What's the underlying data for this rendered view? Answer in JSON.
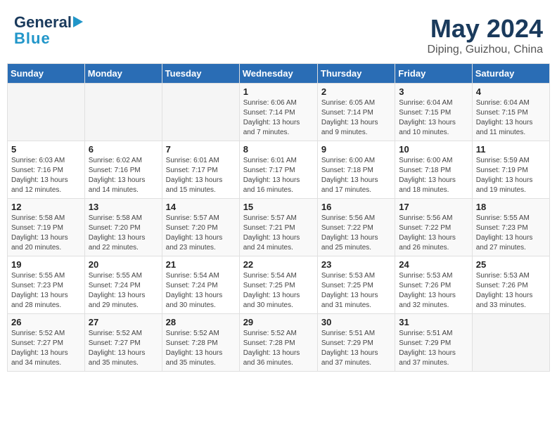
{
  "header": {
    "logo_line1": "General",
    "logo_line2": "Blue",
    "title": "May 2024",
    "subtitle": "Diping, Guizhou, China"
  },
  "weekdays": [
    "Sunday",
    "Monday",
    "Tuesday",
    "Wednesday",
    "Thursday",
    "Friday",
    "Saturday"
  ],
  "weeks": [
    [
      {
        "day": "",
        "info": ""
      },
      {
        "day": "",
        "info": ""
      },
      {
        "day": "",
        "info": ""
      },
      {
        "day": "1",
        "info": "Sunrise: 6:06 AM\nSunset: 7:14 PM\nDaylight: 13 hours\nand 7 minutes."
      },
      {
        "day": "2",
        "info": "Sunrise: 6:05 AM\nSunset: 7:14 PM\nDaylight: 13 hours\nand 9 minutes."
      },
      {
        "day": "3",
        "info": "Sunrise: 6:04 AM\nSunset: 7:15 PM\nDaylight: 13 hours\nand 10 minutes."
      },
      {
        "day": "4",
        "info": "Sunrise: 6:04 AM\nSunset: 7:15 PM\nDaylight: 13 hours\nand 11 minutes."
      }
    ],
    [
      {
        "day": "5",
        "info": "Sunrise: 6:03 AM\nSunset: 7:16 PM\nDaylight: 13 hours\nand 12 minutes."
      },
      {
        "day": "6",
        "info": "Sunrise: 6:02 AM\nSunset: 7:16 PM\nDaylight: 13 hours\nand 14 minutes."
      },
      {
        "day": "7",
        "info": "Sunrise: 6:01 AM\nSunset: 7:17 PM\nDaylight: 13 hours\nand 15 minutes."
      },
      {
        "day": "8",
        "info": "Sunrise: 6:01 AM\nSunset: 7:17 PM\nDaylight: 13 hours\nand 16 minutes."
      },
      {
        "day": "9",
        "info": "Sunrise: 6:00 AM\nSunset: 7:18 PM\nDaylight: 13 hours\nand 17 minutes."
      },
      {
        "day": "10",
        "info": "Sunrise: 6:00 AM\nSunset: 7:18 PM\nDaylight: 13 hours\nand 18 minutes."
      },
      {
        "day": "11",
        "info": "Sunrise: 5:59 AM\nSunset: 7:19 PM\nDaylight: 13 hours\nand 19 minutes."
      }
    ],
    [
      {
        "day": "12",
        "info": "Sunrise: 5:58 AM\nSunset: 7:19 PM\nDaylight: 13 hours\nand 20 minutes."
      },
      {
        "day": "13",
        "info": "Sunrise: 5:58 AM\nSunset: 7:20 PM\nDaylight: 13 hours\nand 22 minutes."
      },
      {
        "day": "14",
        "info": "Sunrise: 5:57 AM\nSunset: 7:20 PM\nDaylight: 13 hours\nand 23 minutes."
      },
      {
        "day": "15",
        "info": "Sunrise: 5:57 AM\nSunset: 7:21 PM\nDaylight: 13 hours\nand 24 minutes."
      },
      {
        "day": "16",
        "info": "Sunrise: 5:56 AM\nSunset: 7:22 PM\nDaylight: 13 hours\nand 25 minutes."
      },
      {
        "day": "17",
        "info": "Sunrise: 5:56 AM\nSunset: 7:22 PM\nDaylight: 13 hours\nand 26 minutes."
      },
      {
        "day": "18",
        "info": "Sunrise: 5:55 AM\nSunset: 7:23 PM\nDaylight: 13 hours\nand 27 minutes."
      }
    ],
    [
      {
        "day": "19",
        "info": "Sunrise: 5:55 AM\nSunset: 7:23 PM\nDaylight: 13 hours\nand 28 minutes."
      },
      {
        "day": "20",
        "info": "Sunrise: 5:55 AM\nSunset: 7:24 PM\nDaylight: 13 hours\nand 29 minutes."
      },
      {
        "day": "21",
        "info": "Sunrise: 5:54 AM\nSunset: 7:24 PM\nDaylight: 13 hours\nand 30 minutes."
      },
      {
        "day": "22",
        "info": "Sunrise: 5:54 AM\nSunset: 7:25 PM\nDaylight: 13 hours\nand 30 minutes."
      },
      {
        "day": "23",
        "info": "Sunrise: 5:53 AM\nSunset: 7:25 PM\nDaylight: 13 hours\nand 31 minutes."
      },
      {
        "day": "24",
        "info": "Sunrise: 5:53 AM\nSunset: 7:26 PM\nDaylight: 13 hours\nand 32 minutes."
      },
      {
        "day": "25",
        "info": "Sunrise: 5:53 AM\nSunset: 7:26 PM\nDaylight: 13 hours\nand 33 minutes."
      }
    ],
    [
      {
        "day": "26",
        "info": "Sunrise: 5:52 AM\nSunset: 7:27 PM\nDaylight: 13 hours\nand 34 minutes."
      },
      {
        "day": "27",
        "info": "Sunrise: 5:52 AM\nSunset: 7:27 PM\nDaylight: 13 hours\nand 35 minutes."
      },
      {
        "day": "28",
        "info": "Sunrise: 5:52 AM\nSunset: 7:28 PM\nDaylight: 13 hours\nand 35 minutes."
      },
      {
        "day": "29",
        "info": "Sunrise: 5:52 AM\nSunset: 7:28 PM\nDaylight: 13 hours\nand 36 minutes."
      },
      {
        "day": "30",
        "info": "Sunrise: 5:51 AM\nSunset: 7:29 PM\nDaylight: 13 hours\nand 37 minutes."
      },
      {
        "day": "31",
        "info": "Sunrise: 5:51 AM\nSunset: 7:29 PM\nDaylight: 13 hours\nand 37 minutes."
      },
      {
        "day": "",
        "info": ""
      }
    ]
  ]
}
